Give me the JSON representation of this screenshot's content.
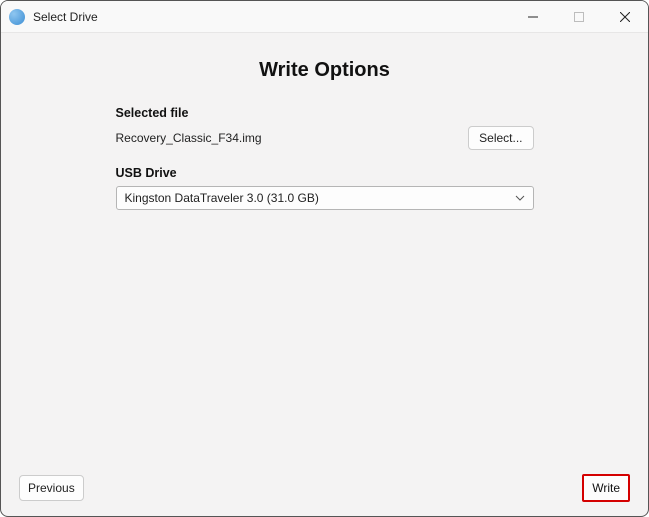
{
  "window": {
    "title": "Select Drive"
  },
  "main": {
    "heading": "Write Options",
    "selected_file_label": "Selected file",
    "selected_file_value": "Recovery_Classic_F34.img",
    "select_button": "Select...",
    "usb_drive_label": "USB Drive",
    "usb_drive_selected": "Kingston DataTraveler 3.0 (31.0 GB)"
  },
  "footer": {
    "previous": "Previous",
    "write": "Write"
  }
}
